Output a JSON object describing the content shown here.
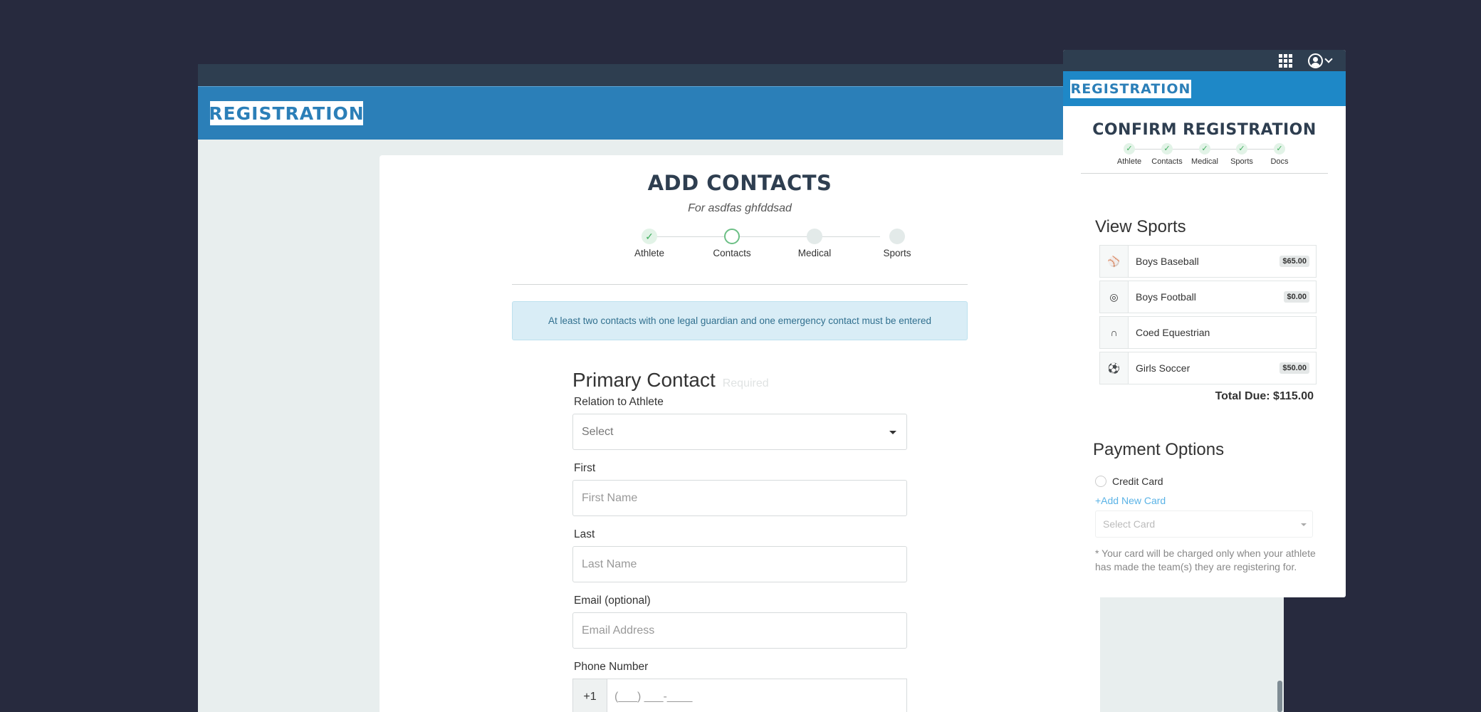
{
  "brand": {
    "logo_text": "REGISTRATION"
  },
  "main": {
    "title": "ADD CONTACTS",
    "subtitle": "For asdfas ghfddsad",
    "steps": [
      "Athlete",
      "Contacts",
      "Medical",
      "Sports"
    ],
    "step_check": "✓",
    "alert": "At least two contacts with one legal guardian and one emergency contact must be entered",
    "form": {
      "heading": "Primary Contact",
      "required_tag": "Required",
      "relation_label": "Relation to Athlete",
      "relation_value": "Select",
      "first_label": "First",
      "first_placeholder": "First Name",
      "last_label": "Last",
      "last_placeholder": "Last Name",
      "email_label": "Email (optional)",
      "email_placeholder": "Email Address",
      "phone_label": "Phone Number",
      "phone_code": "+1",
      "phone_placeholder": "(___) ___-____"
    }
  },
  "panel": {
    "title": "CONFIRM REGISTRATION",
    "steps": [
      "Athlete",
      "Contacts",
      "Medical",
      "Sports",
      "Docs"
    ],
    "sports_heading": "View Sports",
    "sports": [
      {
        "icon": "baseball-icon",
        "glyph": "⚾",
        "name": "Boys Baseball",
        "price": "$65.00"
      },
      {
        "icon": "football-icon",
        "glyph": "◎",
        "name": "Boys Football",
        "price": "$0.00"
      },
      {
        "icon": "horseshoe-icon",
        "glyph": "∩",
        "name": "Coed Equestrian",
        "price": ""
      },
      {
        "icon": "soccer-ball-icon",
        "glyph": "⚽",
        "name": "Girls Soccer",
        "price": "$50.00"
      }
    ],
    "total": "Total Due: $115.00",
    "payment_heading": "Payment Options",
    "credit_card_label": "Credit Card",
    "add_card_link": "+Add New Card",
    "select_card_placeholder": "Select Card",
    "note": "* Your card will be charged only when your athlete has made the team(s) they are registering for."
  },
  "colors": {
    "header_blue": "#2b7fb8",
    "panel_header_blue": "#1e88c7",
    "topbar": "#2e3e50",
    "success_green": "#3fae5e",
    "link_blue": "#5bb3e6"
  }
}
